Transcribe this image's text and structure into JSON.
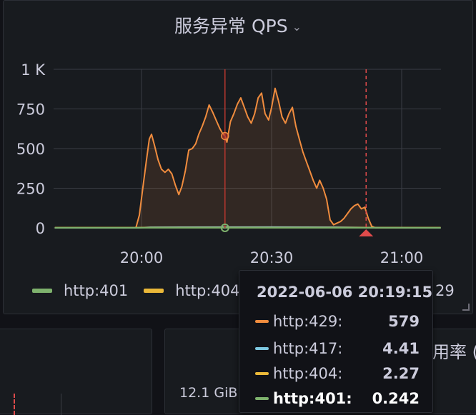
{
  "panel": {
    "title": "服务异常 QPS",
    "chevron_icon": "chevron-down-icon"
  },
  "colors": {
    "background": "#111217",
    "panel": "#181b1f",
    "grid": "#3a3d44",
    "http429": "#f08c3e",
    "http417": "#7dc7e0",
    "http404": "#eab839",
    "http401": "#7eb26d",
    "crosshair": "#b8372f",
    "annotation": "#e04b4b"
  },
  "chart_data": {
    "type": "area",
    "title": "服务异常 QPS",
    "ylim": [
      0,
      1000
    ],
    "y_ticks": [
      0,
      250,
      500,
      750,
      1000
    ],
    "y_tick_labels": [
      "0",
      "250",
      "500",
      "750",
      "1 K"
    ],
    "x_ticks": [
      "20:00",
      "20:30",
      "21:00"
    ],
    "x_tick_minutes": [
      0,
      30,
      60
    ],
    "x_range_minutes": [
      -20,
      69
    ],
    "crosshair_minutes": 19.25,
    "annotation_minutes": 51.8,
    "grid": true,
    "series": [
      {
        "name": "http:429",
        "color": "#f08c3e",
        "x": [
          -20,
          -1.3,
          -0.5,
          0.3,
          1.1,
          1.8,
          2.3,
          3.0,
          3.8,
          4.6,
          5.4,
          6.2,
          7.0,
          7.8,
          8.6,
          9.3,
          10.1,
          10.9,
          11.7,
          12.5,
          13.2,
          14.0,
          14.8,
          15.6,
          16.4,
          17.2,
          18.0,
          18.6,
          19.25,
          19.7,
          20.5,
          21.3,
          22.1,
          22.9,
          23.7,
          24.5,
          25.3,
          26.1,
          26.9,
          27.7,
          28.5,
          29.3,
          30.0,
          30.8,
          31.6,
          32.4,
          33.2,
          34.0,
          34.8,
          35.6,
          36.4,
          37.2,
          38.0,
          38.8,
          39.6,
          40.4,
          41.1,
          41.9,
          42.7,
          43.5,
          44.3,
          45.1,
          45.9,
          46.7,
          47.5,
          48.3,
          49.1,
          49.9,
          50.7,
          51.5,
          52.3,
          53.1,
          54.0,
          69
        ],
        "values": [
          0,
          0,
          80,
          250,
          420,
          560,
          590,
          520,
          430,
          370,
          350,
          370,
          340,
          270,
          210,
          260,
          360,
          490,
          500,
          530,
          590,
          640,
          700,
          775,
          730,
          680,
          630,
          600,
          579,
          540,
          670,
          720,
          780,
          820,
          760,
          700,
          660,
          720,
          820,
          850,
          720,
          680,
          760,
          880,
          800,
          700,
          660,
          720,
          760,
          640,
          560,
          480,
          420,
          360,
          300,
          250,
          300,
          250,
          180,
          50,
          20,
          30,
          40,
          60,
          90,
          120,
          140,
          150,
          120,
          130,
          60,
          10,
          0,
          0
        ]
      },
      {
        "name": "http:417",
        "color": "#7dc7e0",
        "x": [
          -20,
          -1,
          2,
          30,
          45,
          52,
          69
        ],
        "values": [
          0,
          0,
          4,
          5,
          4,
          2,
          0
        ]
      },
      {
        "name": "http:404",
        "color": "#eab839",
        "x": [
          -20,
          69
        ],
        "values": [
          2,
          2
        ]
      },
      {
        "name": "http:401",
        "color": "#7eb26d",
        "x": [
          -20,
          69
        ],
        "values": [
          0.24,
          0.24
        ]
      }
    ]
  },
  "legend": {
    "items": [
      {
        "label": "http:401",
        "color": "#7eb26d"
      },
      {
        "label": "http:404",
        "color": "#eab839"
      }
    ],
    "overflow_label": "29"
  },
  "tooltip": {
    "time": "2022-06-06 20:19:15",
    "rows": [
      {
        "name": "http:429:",
        "value": "579",
        "color": "#f08c3e"
      },
      {
        "name": "http:417:",
        "value": "4.41",
        "color": "#7dc7e0"
      },
      {
        "name": "http:404:",
        "value": "2.27",
        "color": "#eab839"
      },
      {
        "name": "http:401:",
        "value": "0.242",
        "color": "#7eb26d"
      }
    ]
  },
  "lower_panels": {
    "right_title": "用率 (",
    "left_value": "12.1 GiB"
  }
}
